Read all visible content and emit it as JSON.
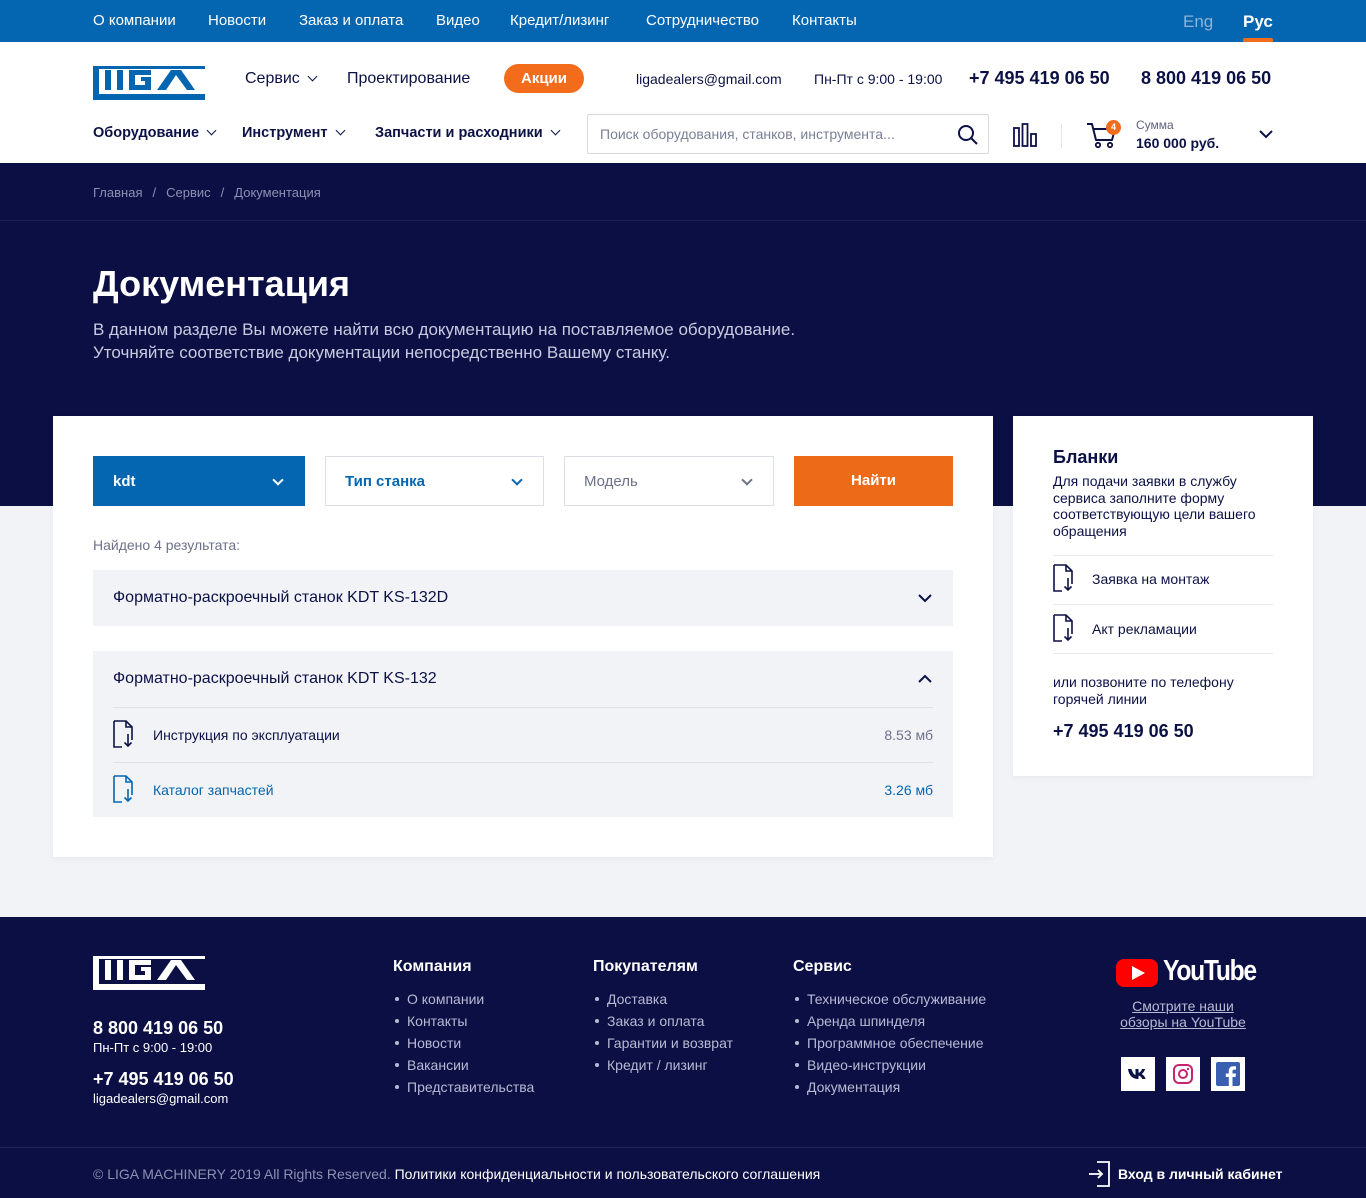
{
  "topnav": {
    "items": [
      "О компании",
      "Новости",
      "Заказ и оплата",
      "Видео",
      "Кредит/лизинг",
      "Сотрудничество",
      "Контакты"
    ],
    "lang_eng": "Eng",
    "lang_rus": "Рус"
  },
  "header": {
    "logo_text": "LIGA",
    "menu": {
      "service": "Сервис",
      "design": "Проектирование",
      "promo": "Акции"
    },
    "email": "ligadealers@gmail.com",
    "hours": "Пн-Пт с 9:00 - 19:00",
    "phone1": "+7 495 419 06 50",
    "phone2": "8 800 419 06 50",
    "categories": [
      "Оборудование",
      "Инструмент",
      "Запчасти и расходники"
    ],
    "search_placeholder": "Поиск оборудования, станков, инструмента...",
    "cart_count": "4",
    "cart_sum_label": "Сумма",
    "cart_sum_value": "160 000 руб."
  },
  "breadcrumb": [
    "Главная",
    "Сервис",
    "Документация"
  ],
  "hero": {
    "title": "Документация",
    "desc_line1": "В данном разделе Вы можете найти всю документацию на поставляемое оборудование.",
    "desc_line2": "Уточняйте соответствие документации непосредственно Вашему станку."
  },
  "filters": {
    "brand": "kdt",
    "type": "Тип станка",
    "model": "Модель",
    "find": "Найти"
  },
  "results": {
    "found_text": "Найдено 4 результата:",
    "items": [
      {
        "title": "Форматно-раскроечный станок KDT KS-132D",
        "expanded": false
      },
      {
        "title": "Форматно-раскроечный станок KDT KS-132",
        "expanded": true,
        "docs": [
          {
            "name": "Инструкция по эксплуатации",
            "size": "8.53 мб"
          },
          {
            "name": "Каталог запчастей",
            "size": "3.26 мб"
          }
        ]
      }
    ]
  },
  "sidebar": {
    "title": "Бланки",
    "desc": "Для подачи заявки в службу сервиса заполните форму соответствующую цели вашего обращения",
    "links": [
      "Заявка на монтаж",
      "Акт рекламации"
    ],
    "call_text": "или позвоните по телефону горячей линии",
    "phone": "+7 495 419 06 50"
  },
  "footer": {
    "phone1": "8 800 419 06 50",
    "hours": "Пн-Пт с 9:00 - 19:00",
    "phone2": "+7 495 419 06 50",
    "email": "ligadealers@gmail.com",
    "columns": [
      {
        "title": "Компания",
        "items": [
          "О компании",
          "Контакты",
          "Новости",
          "Вакансии",
          "Представительства"
        ]
      },
      {
        "title": "Покупателям",
        "items": [
          "Доставка",
          "Заказ и оплата",
          "Гарантии и возврат",
          "Кредит / лизинг"
        ]
      },
      {
        "title": "Сервис",
        "items": [
          "Техническое обслуживание",
          "Аренда шпинделя",
          "Программное обеспечение",
          "Видео-инструкции",
          "Документация"
        ]
      }
    ],
    "youtube_text": "YouTube",
    "youtube_link": "Смотрите наши обзоры на YouTube",
    "copyright": "© LIGA MACHINERY 2019 All Rights Reserved.",
    "policy": "Политики конфиденциальности и пользовательского соглашения",
    "login": "Вход в личный кабинет"
  },
  "colors": {
    "brand_blue": "#0466b0",
    "navy": "#0c0f44",
    "accent_orange": "#ec6a18"
  },
  "icons": [
    "search-icon",
    "compare-icon",
    "cart-icon",
    "chevron-down-icon",
    "chevron-up-icon",
    "document-download-icon",
    "youtube-icon",
    "vk-icon",
    "instagram-icon",
    "facebook-icon",
    "login-icon"
  ]
}
